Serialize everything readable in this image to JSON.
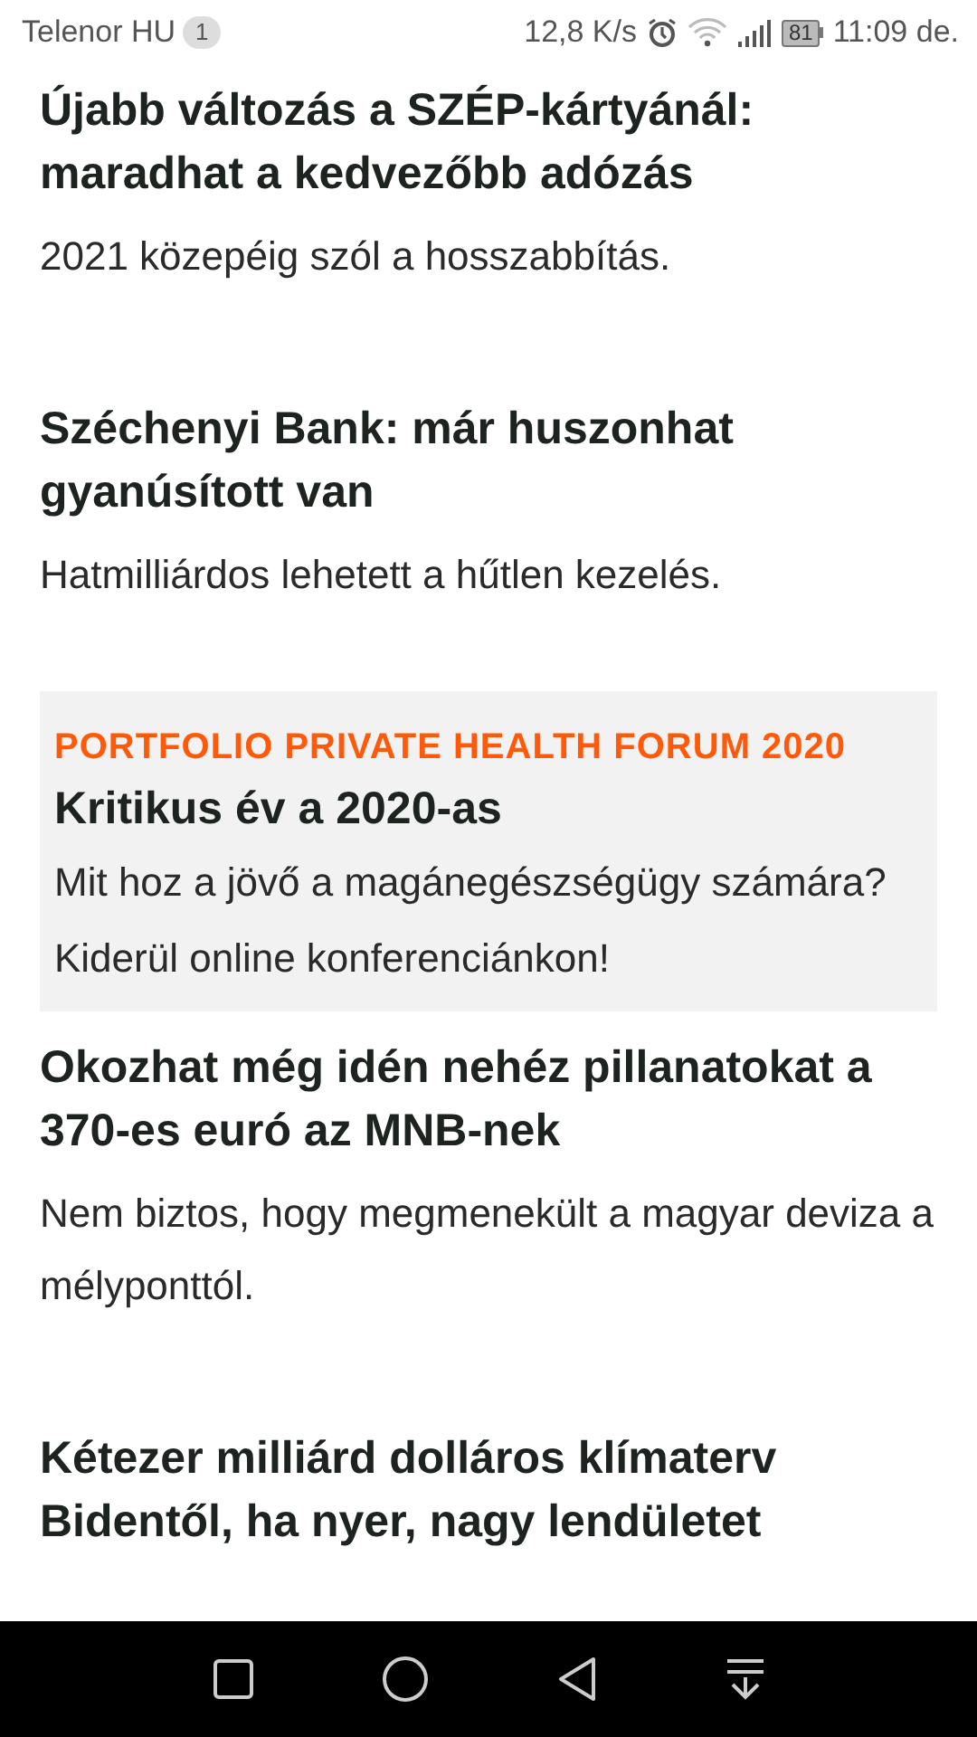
{
  "status_bar": {
    "carrier": "Telenor HU",
    "notification_count": "1",
    "speed": "12,8 K/s",
    "battery": "81",
    "time": "11:09 de."
  },
  "articles": [
    {
      "kind": "article",
      "title": "Újabb változás a SZÉP-kártyánál: maradhat a kedvezőbb adózás",
      "lead": "2021 közepéig szól a hosszabbítás."
    },
    {
      "kind": "article",
      "title": "Széchenyi Bank: már huszonhat gyanúsított van",
      "lead": "Hatmilliárdos lehetett a hűtlen kezelés."
    },
    {
      "kind": "sponsored",
      "label": "PORTFOLIO PRIVATE HEALTH FORUM 2020",
      "title": "Kritikus év a 2020-as",
      "lead": "Mit hoz a jövő a magánegészségügy számára? Kiderül online konferenciánkon!"
    },
    {
      "kind": "article",
      "title": "Okozhat még idén nehéz pillanatokat a 370-es euró az MNB-nek",
      "lead": "Nem biztos, hogy megmenekült a magyar deviza a mélyponttól."
    },
    {
      "kind": "article",
      "title": "Kétezer milliárd dolláros klímaterv Bidentől, ha nyer, nagy lendületet"
    }
  ]
}
